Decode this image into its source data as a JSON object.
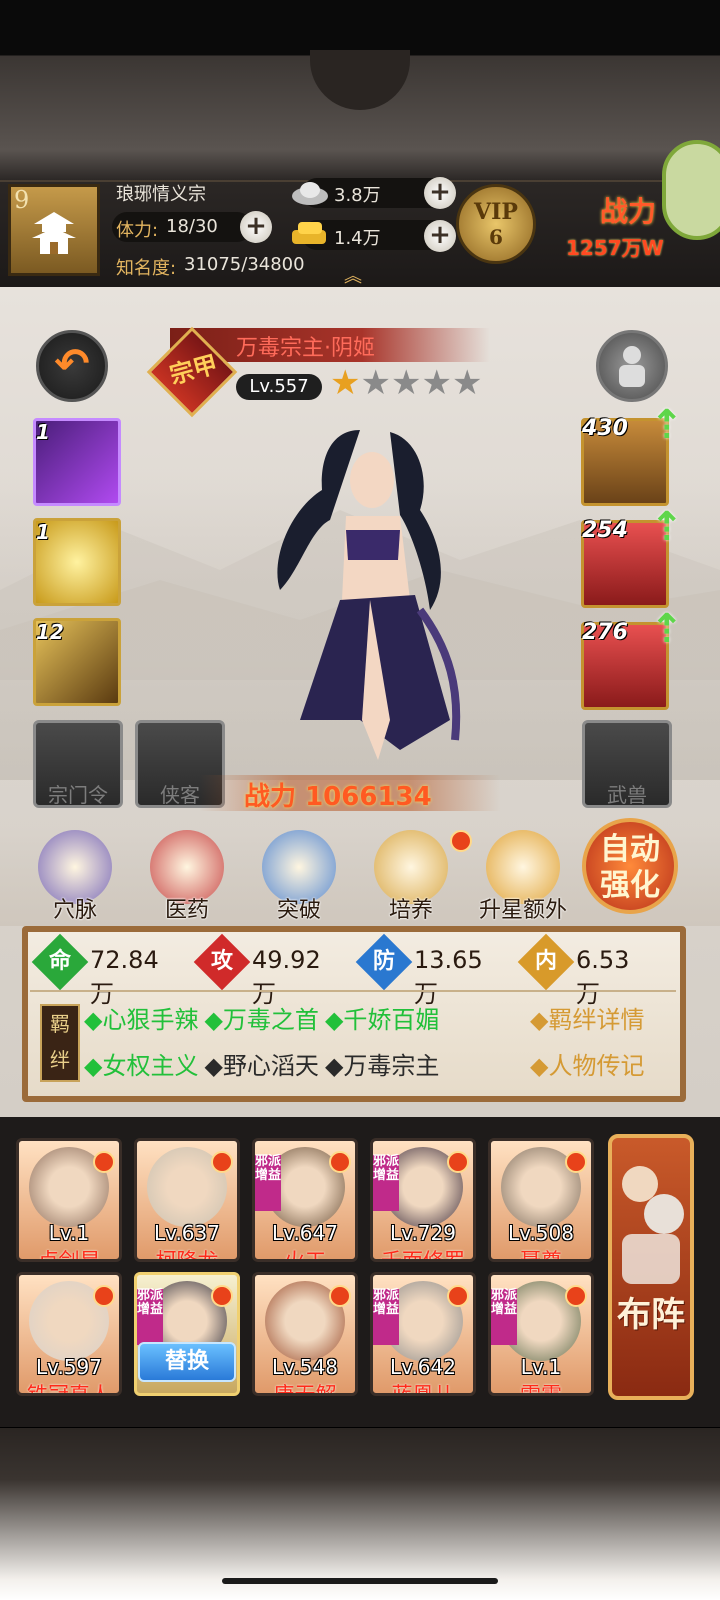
{
  "player": {
    "level": "9",
    "sect_name": "琅琊情义宗",
    "stamina_label": "体力:",
    "stamina_value": "18/30",
    "fame_label": "知名度:",
    "fame_value": "31075/34800",
    "silver": "3.8万",
    "gold": "1.4万",
    "vip_label": "VIP",
    "vip_level": "6",
    "power_label": "战力",
    "power_value": "1257万W"
  },
  "hero": {
    "name": "万毒宗主·阴姬",
    "faction": "宗甲",
    "level": "Lv.557",
    "stars_filled": 1,
    "stars_total": 5,
    "power_label": "战力",
    "power_value": "1066134",
    "skills": [
      {
        "count": "1",
        "color": "purple"
      },
      {
        "count": "1",
        "color": "gold"
      },
      {
        "count": "12",
        "color": "gold"
      }
    ],
    "empty_slots": {
      "left1": "宗门令",
      "left2": "侠客",
      "right": "武兽"
    },
    "equipment": [
      {
        "value": "430",
        "color": "#a8742a"
      },
      {
        "value": "254",
        "color": "#c42a2a"
      },
      {
        "value": "276",
        "color": "#c42a2a"
      }
    ]
  },
  "functions": [
    {
      "label": "穴脉",
      "icon": "meridian-icon",
      "color": "#7a6ab8"
    },
    {
      "label": "医药",
      "icon": "medicine-icon",
      "color": "#c84a4a"
    },
    {
      "label": "突破",
      "icon": "breakthrough-icon",
      "color": "#5a8ad0"
    },
    {
      "label": "培养",
      "icon": "cultivate-icon",
      "color": "#d8a84a"
    },
    {
      "label": "升星额外",
      "icon": "star-upgrade-icon",
      "color": "#e0a43a"
    }
  ],
  "auto_enhance": "自动强化",
  "stats": [
    {
      "icon": "命",
      "value": "72.84万",
      "color": "#2aa83a"
    },
    {
      "icon": "攻",
      "value": "49.92万",
      "color": "#d02a2a"
    },
    {
      "icon": "防",
      "value": "13.65万",
      "color": "#2a78d0"
    },
    {
      "icon": "内",
      "value": "6.53万",
      "color": "#d89a2a"
    }
  ],
  "fetter": {
    "seal": "羁绊",
    "row1": [
      {
        "text": "◆心狠手辣",
        "active": true
      },
      {
        "text": "◆万毒之首",
        "active": true
      },
      {
        "text": "◆千娇百媚",
        "active": true
      }
    ],
    "row2": [
      {
        "text": "◆女权主义",
        "active": true
      },
      {
        "text": "◆野心滔天",
        "active": false
      },
      {
        "text": "◆万毒宗主",
        "active": false
      }
    ],
    "detail_link": "◆羁绊详情",
    "bio_link": "◆人物传记"
  },
  "roster": [
    {
      "level": "Lv.1",
      "name": "卢剑星",
      "evil": false,
      "face": "#8a6a58"
    },
    {
      "level": "Lv.637",
      "name": "柯降龙",
      "evil": false,
      "face": "#c8c0b0"
    },
    {
      "level": "Lv.647",
      "name": "火工",
      "evil": true,
      "face": "#6a5038"
    },
    {
      "level": "Lv.729",
      "name": "千面修罗",
      "evil": true,
      "face": "#3a2a3a"
    },
    {
      "level": "Lv.508",
      "name": "聂尊",
      "evil": false,
      "face": "#7a6a5a"
    },
    {
      "level": "Lv.597",
      "name": "铁冠真人",
      "evil": false,
      "face": "#d8d0c8"
    },
    {
      "level": "",
      "name": "",
      "evil": true,
      "face": "#2a2a38"
    },
    {
      "level": "Lv.548",
      "name": "唐无解",
      "evil": false,
      "face": "#9a4a2a"
    },
    {
      "level": "Lv.642",
      "name": "蓝凰儿",
      "evil": true,
      "face": "#8a8a8a"
    },
    {
      "level": "Lv.1",
      "name": "雷震",
      "evil": true,
      "face": "#5a6a4a"
    }
  ],
  "evil_tag": "邪派增益",
  "swap_label": "替换",
  "formation_label": "布阵"
}
